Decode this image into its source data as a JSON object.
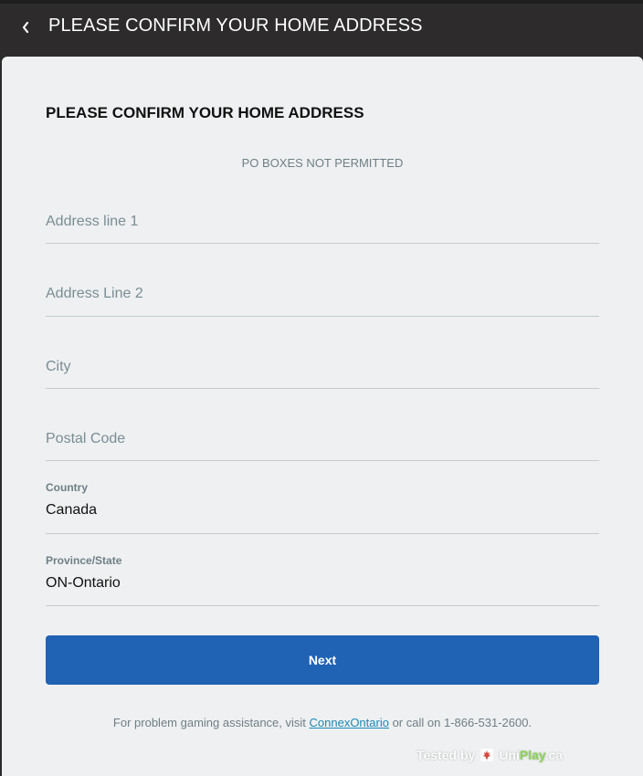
{
  "header": {
    "title": "PLEASE CONFIRM YOUR HOME ADDRESS",
    "back_icon": "chevron-left-icon"
  },
  "form": {
    "heading": "PLEASE CONFIRM YOUR HOME ADDRESS",
    "notice": "PO BOXES NOT PERMITTED",
    "address_line_1": {
      "placeholder": "Address line 1",
      "value": ""
    },
    "address_line_2": {
      "placeholder": "Address Line 2",
      "value": ""
    },
    "city": {
      "placeholder": "City",
      "value": ""
    },
    "postal_code": {
      "placeholder": "Postal Code",
      "value": ""
    },
    "country": {
      "label": "Country",
      "value": "Canada"
    },
    "province": {
      "label": "Province/State",
      "value": "ON-Ontario"
    },
    "next_label": "Next"
  },
  "footer": {
    "prefix": "For problem gaming assistance, visit ",
    "link_text": "ConnexOntario",
    "suffix": " or call on 1-866-531-2600."
  },
  "watermark": {
    "tested_by": "Tested by",
    "brand_uni": "Uni",
    "brand_play": "Play",
    "brand_tld": ".ca"
  },
  "colors": {
    "topbar": "#2d2b2b",
    "panel": "#eef0f1",
    "primary_button": "#2062b3",
    "link": "#1a8ab8"
  }
}
